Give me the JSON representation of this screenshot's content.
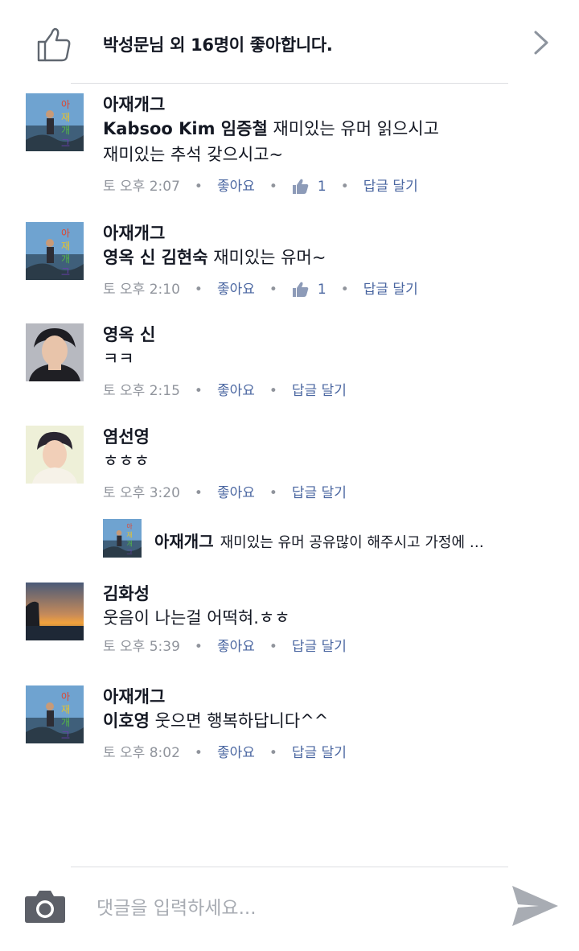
{
  "header": {
    "likes_text": "박성문님 외 16명이 좋아합니다."
  },
  "comments": [
    {
      "name": "아재개그",
      "tag": "Kabsoo Kim 임증철",
      "line1": " 재미있는 유머 읽으시고",
      "line2": "재미있는 추석 갖으시고~",
      "time": "토 오후 2:07",
      "like_label": "좋아요",
      "reaction_count": "1",
      "reply_label": "답글 달기"
    },
    {
      "name": "아재개그",
      "tag": "영옥 신 김현숙",
      "line1": " 재미있는 유머~",
      "time": "토 오후 2:10",
      "like_label": "좋아요",
      "reaction_count": "1",
      "reply_label": "답글 달기"
    },
    {
      "name": "영옥 신",
      "line1": "ㅋㅋ",
      "time": "토 오후 2:15",
      "like_label": "좋아요",
      "reply_label": "답글 달기"
    },
    {
      "name": "염선영",
      "line1": "ㅎㅎㅎ",
      "time": "토 오후 3:20",
      "like_label": "좋아요",
      "reply_label": "답글 달기",
      "reply_preview": {
        "name": "아재개그",
        "text": "재미있는 유머 공유많이 해주시고 가정에 …"
      }
    },
    {
      "name": "김화성",
      "line1": "웃음이 나는걸 어떡혀.ㅎㅎ",
      "time": "토 오후 5:39",
      "like_label": "좋아요",
      "reply_label": "답글 달기"
    },
    {
      "name": "아재개그",
      "tag": "이호영",
      "line1": " 웃으면 행복하답니다^^",
      "time": "토 오후 8:02",
      "like_label": "좋아요",
      "reply_label": "답글 달기"
    }
  ],
  "composer": {
    "placeholder": "댓글을 입력하세요...",
    "value": ""
  },
  "colors": {
    "link": "#4b67a1",
    "meta": "#90949c",
    "icon": "#606770",
    "send": "#a8acb3"
  }
}
